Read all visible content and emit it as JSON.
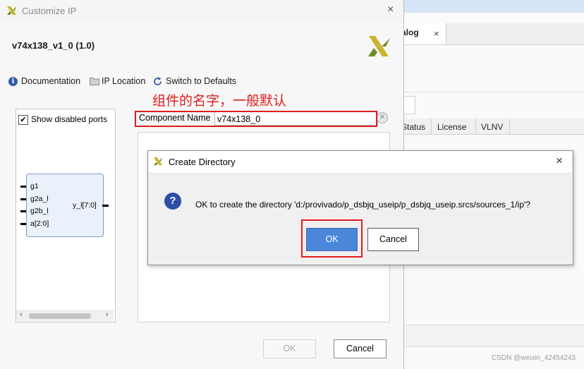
{
  "background_window": {
    "tab_label": "alog",
    "tab_close": "×",
    "columns": [
      "Status",
      "License",
      "VLNV"
    ]
  },
  "customize_ip": {
    "title": "Customize IP",
    "close": "×",
    "ip_name": "v74x138_v1_0 (1.0)",
    "toolbar": {
      "documentation": "Documentation",
      "ip_location": "IP Location",
      "switch_defaults": "Switch to Defaults"
    },
    "show_disabled_ports": {
      "label": "Show disabled ports",
      "checked": true
    },
    "ports_left": [
      "g1",
      "g2a_l",
      "g2b_l",
      "a[2:0]"
    ],
    "port_right": "y_l[7:0]",
    "component_name_label": "Component Name",
    "component_name_value": "v74x138_0",
    "annotation": "组件的名字，一般默认",
    "ok": "OK",
    "cancel": "Cancel"
  },
  "create_directory": {
    "title": "Create Directory",
    "close": "×",
    "message": "OK to create the directory 'd:/provivado/p_dsbjq_useip/p_dsbjq_useip.srcs/sources_1/ip'?",
    "ok": "OK",
    "cancel": "Cancel"
  },
  "watermark": "CSDN @weixin_42454243",
  "colors": {
    "annotation_red": "#e11c1c",
    "primary_button": "#4b87d9",
    "question_icon": "#2c4ea7",
    "block_fill": "#e9f1fb"
  }
}
